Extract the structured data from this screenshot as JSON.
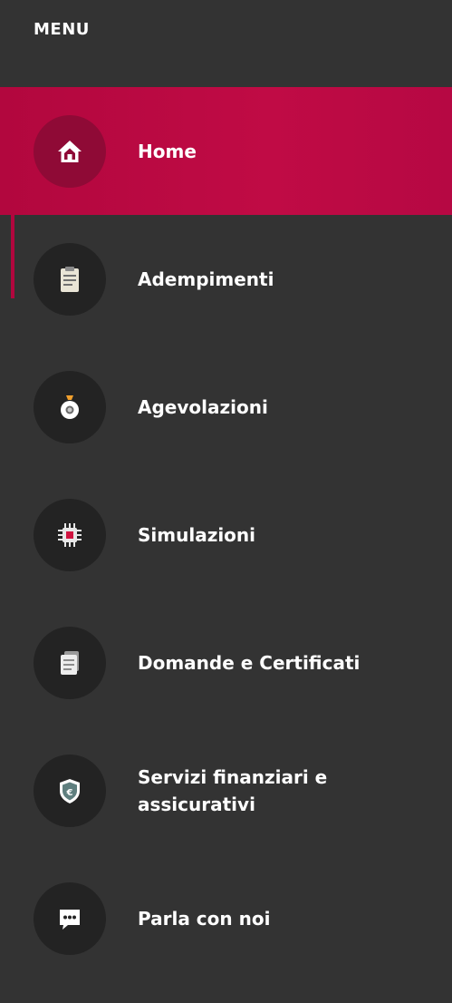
{
  "menu": {
    "title": "MENU",
    "items": [
      {
        "label": "Home",
        "icon": "home-icon",
        "active": true
      },
      {
        "label": "Adempimenti",
        "icon": "clipboard-icon",
        "active": false
      },
      {
        "label": "Agevolazioni",
        "icon": "money-bag-icon",
        "active": false
      },
      {
        "label": "Simulazioni",
        "icon": "chip-icon",
        "active": false
      },
      {
        "label": "Domande e Certificati",
        "icon": "documents-icon",
        "active": false
      },
      {
        "label": "Servizi finanziari e assicurativi",
        "icon": "shield-euro-icon",
        "active": false
      },
      {
        "label": "Parla con noi",
        "icon": "chat-icon",
        "active": false
      }
    ]
  },
  "colors": {
    "background": "#333333",
    "active": "#b2073e",
    "icon_circle": "#232323",
    "text": "#ffffff"
  }
}
